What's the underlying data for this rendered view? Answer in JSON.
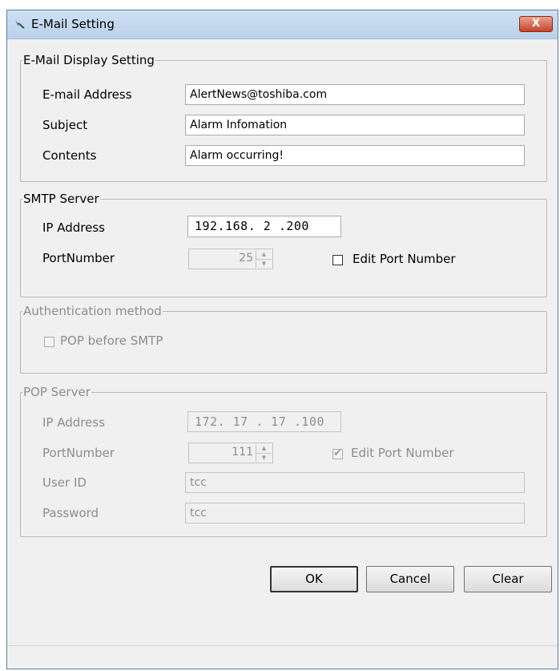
{
  "window": {
    "title": "E-Mail Setting",
    "close_label": "X"
  },
  "display": {
    "legend": "E-Mail Display Setting",
    "email_label": "E-mail Address",
    "email_value": "AlertNews@toshiba.com",
    "subject_label": "Subject",
    "subject_value": "Alarm Infomation",
    "contents_label": "Contents",
    "contents_value": "Alarm occurring!"
  },
  "smtp": {
    "legend": "SMTP Server",
    "ip_label": "IP Address",
    "ip_value": "192.168. 2 .200",
    "port_label": "PortNumber",
    "port_value": "25",
    "edit_port_label": "Edit Port Number",
    "edit_port_checked": false
  },
  "auth": {
    "legend": "Authentication method",
    "pop_before_smtp_label": "POP before SMTP",
    "pop_before_smtp_checked": false
  },
  "pop": {
    "legend": "POP Server",
    "ip_label": "IP Address",
    "ip_value": "172. 17 . 17 .100",
    "port_label": "PortNumber",
    "port_value": "111",
    "edit_port_label": "Edit Port Number",
    "edit_port_checked": true,
    "userid_label": "User ID",
    "userid_value": "tcc",
    "password_label": "Password",
    "password_value": "tcc"
  },
  "buttons": {
    "ok": "OK",
    "cancel": "Cancel",
    "clear": "Clear"
  }
}
